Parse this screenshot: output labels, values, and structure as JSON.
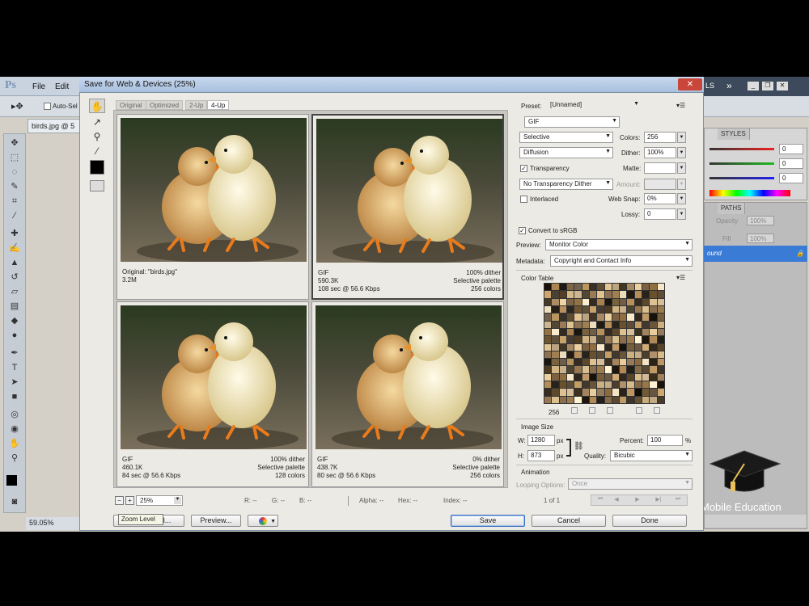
{
  "photoshop": {
    "logo": "Ps",
    "menu": [
      "File",
      "Edit"
    ],
    "options_bar": {
      "auto_select": "Auto-Sel"
    },
    "doc_tab": "birds.jpg @ 5",
    "status_zoom": "59.05%",
    "panels": {
      "styles_tab": "STYLES",
      "paths_tab": "PATHS",
      "ls_label": "LS",
      "slider_values": [
        "0",
        "0",
        "0"
      ],
      "opacity": "100%",
      "fill": "100%",
      "opacity_label": "Opacity",
      "fill_label": "Fill",
      "layer_name": "ound"
    },
    "watermark": "Mobile Education"
  },
  "dialog": {
    "title": "Save for Web & Devices (25%)",
    "close": "✕",
    "view_tabs": [
      "Original",
      "Optimized",
      "2-Up",
      "4-Up"
    ],
    "active_tab": "4-Up",
    "panes": [
      {
        "left": "Original: \"birds.jpg\"",
        "left2": "3.2M",
        "left3": "",
        "right1": "",
        "right2": "",
        "right3": ""
      },
      {
        "left": "GIF",
        "left2": "590.3K",
        "left3": "108 sec @ 56.6 Kbps",
        "right1": "100% dither",
        "right2": "Selective palette",
        "right3": "256 colors"
      },
      {
        "left": "GIF",
        "left2": "460.1K",
        "left3": "84 sec @ 56.6 Kbps",
        "right1": "100% dither",
        "right2": "Selective palette",
        "right3": "128 colors"
      },
      {
        "left": "GIF",
        "left2": "438.7K",
        "left3": "80 sec @ 56.6 Kbps",
        "right1": "0% dither",
        "right2": "Selective palette",
        "right3": "256 colors"
      }
    ],
    "zoom": {
      "value": "25%",
      "tooltip": "Zoom Level",
      "minus": "−",
      "plus": "+"
    },
    "readouts": {
      "r": "R: --",
      "g": "G: --",
      "b": "B: --",
      "alpha": "Alpha: --",
      "hex": "Hex: --",
      "index": "Index: --"
    },
    "buttons": {
      "device": "al...",
      "preview": "Preview...",
      "save": "Save",
      "cancel": "Cancel",
      "done": "Done"
    },
    "settings": {
      "preset_label": "Preset:",
      "preset_value": "[Unnamed]",
      "format": "GIF",
      "reduction": "Selective",
      "colors_label": "Colors:",
      "colors_value": "256",
      "dither_algo": "Diffusion",
      "dither_label": "Dither:",
      "dither_value": "100%",
      "transparency_label": "Transparency",
      "matte_label": "Matte:",
      "trans_dither": "No Transparency Dither",
      "amount_label": "Amount:",
      "interlaced_label": "Interlaced",
      "websnap_label": "Web Snap:",
      "websnap_value": "0%",
      "lossy_label": "Lossy:",
      "lossy_value": "0",
      "convert_label": "Convert to sRGB",
      "preview_label": "Preview:",
      "preview_value": "Monitor Color",
      "metadata_label": "Metadata:",
      "metadata_value": "Copyright and Contact Info",
      "color_table_label": "Color Table",
      "color_count": "256",
      "image_size_label": "Image Size",
      "w_label": "W:",
      "w_value": "1280",
      "h_label": "H:",
      "h_value": "873",
      "px": "px",
      "percent_label": "Percent:",
      "percent_value": "100",
      "percent_unit": "%",
      "quality_label": "Quality:",
      "quality_value": "Bicubic",
      "animation_label": "Animation",
      "looping_label": "Looping Options:",
      "looping_value": "Once",
      "frame_counter": "1 of 1"
    }
  },
  "colors": {
    "accent": "#3a7bd5",
    "title_bar": "#a9c0de"
  }
}
